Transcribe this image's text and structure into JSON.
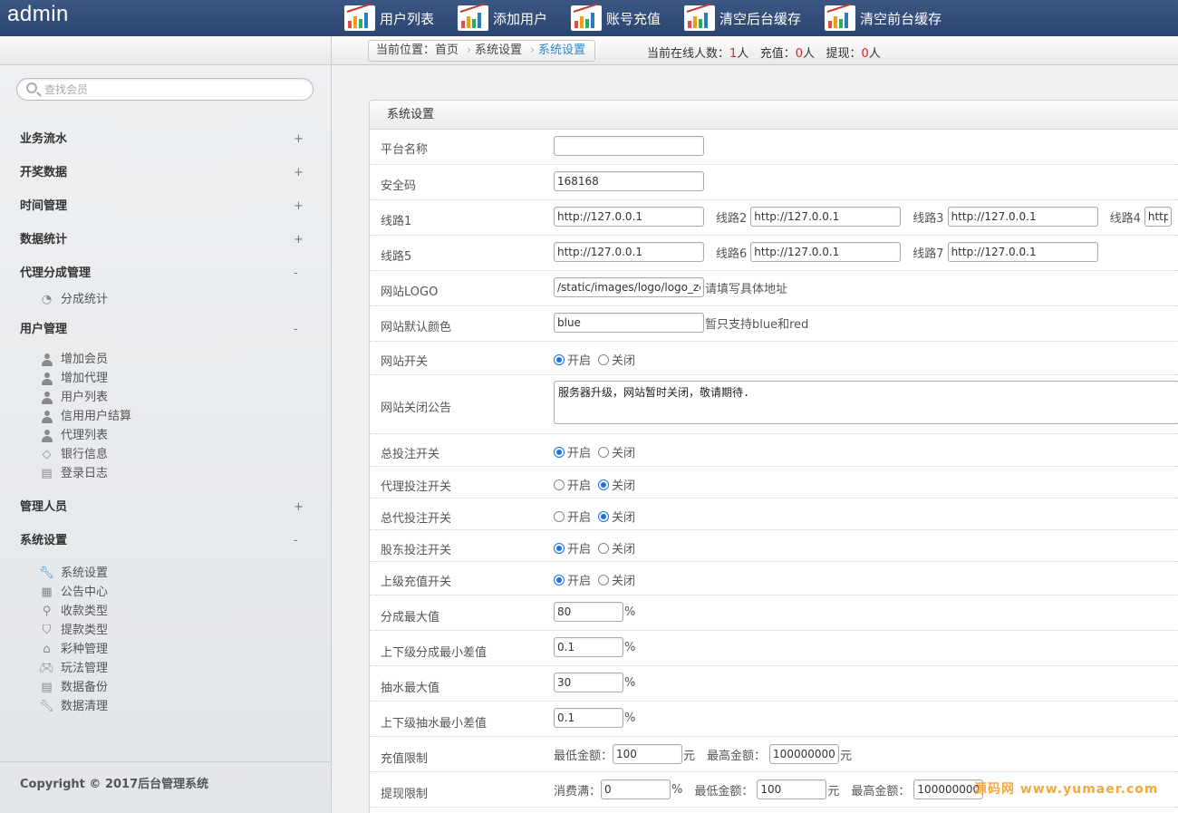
{
  "app": {
    "title": "admin"
  },
  "topnav": [
    {
      "label": "用户列表"
    },
    {
      "label": "添加用户"
    },
    {
      "label": "账号充值"
    },
    {
      "label": "清空后台缓存"
    },
    {
      "label": "清空前台缓存"
    }
  ],
  "search": {
    "placeholder": "查找会员"
  },
  "sidebar": {
    "groups": [
      {
        "label": "业务流水",
        "toggle": "+"
      },
      {
        "label": "开奖数据",
        "toggle": "+"
      },
      {
        "label": "时间管理",
        "toggle": "+"
      },
      {
        "label": "数据统计",
        "toggle": "+"
      },
      {
        "label": "代理分成管理",
        "toggle": "-",
        "items": [
          {
            "label": "分成统计",
            "icon": "pie-icon"
          }
        ]
      },
      {
        "label": "用户管理",
        "toggle": "-",
        "items": [
          {
            "label": "增加会员",
            "icon": "user-add-icon"
          },
          {
            "label": "增加代理",
            "icon": "user-add-icon"
          },
          {
            "label": "用户列表",
            "icon": "user-icon"
          },
          {
            "label": "信用用户结算",
            "icon": "user-icon"
          },
          {
            "label": "代理列表",
            "icon": "user-icon"
          },
          {
            "label": "银行信息",
            "icon": "diamond-icon"
          },
          {
            "label": "登录日志",
            "icon": "log-icon"
          }
        ]
      },
      {
        "label": "管理人员",
        "toggle": "+"
      },
      {
        "label": "系统设置",
        "toggle": "-",
        "items": [
          {
            "label": "系统设置",
            "icon": "wrench-icon"
          },
          {
            "label": "公告中心",
            "icon": "doc-icon"
          },
          {
            "label": "收款类型",
            "icon": "search-icon"
          },
          {
            "label": "提款类型",
            "icon": "shield-icon"
          },
          {
            "label": "彩种管理",
            "icon": "home-icon"
          },
          {
            "label": "玩法管理",
            "icon": "gamepad-icon"
          },
          {
            "label": "数据备份",
            "icon": "log-icon"
          },
          {
            "label": "数据清理",
            "icon": "wrench-icon"
          }
        ]
      }
    ],
    "copyright": "Copyright © 2017后台管理系统"
  },
  "breadcrumb": {
    "prefix": "当前位置：首页",
    "mid": "系统设置",
    "current": "系统设置"
  },
  "online": {
    "label1": "当前在线人数：",
    "count1": "1",
    "unit1": "人",
    "label2": "充值：",
    "count2": "0",
    "unit2": "人",
    "label3": "提现：",
    "count3": "0",
    "unit3": "人"
  },
  "panel": {
    "title": "系统设置"
  },
  "form": {
    "platform_name": {
      "label": "平台名称",
      "value": ""
    },
    "security_code": {
      "label": "安全码",
      "value": "168168"
    },
    "lines_a": {
      "label": "线路1",
      "value1": "http://127.0.0.1",
      "label2": "线路2",
      "value2": "http://127.0.0.1",
      "label3": "线路3",
      "value3": "http://127.0.0.1",
      "label4": "线路4",
      "value4": "http://"
    },
    "lines_b": {
      "label": "线路5",
      "value1": "http://127.0.0.1",
      "label2": "线路6",
      "value2": "http://127.0.0.1",
      "label3": "线路7",
      "value3": "http://127.0.0.1"
    },
    "logo": {
      "label": "网站LOGO",
      "value": "/static/images/logo/logo_zc.png",
      "hint": "请填写具体地址"
    },
    "color": {
      "label": "网站默认颜色",
      "value": "blue",
      "hint": "暂只支持blue和red"
    },
    "site_switch": {
      "label": "网站开关"
    },
    "close_notice": {
      "label": "网站关闭公告",
      "value": "服务器升级，网站暂时关闭，敬请期待."
    },
    "bet_total": {
      "label": "总投注开关"
    },
    "bet_agent": {
      "label": "代理投注开关"
    },
    "bet_general": {
      "label": "总代投注开关"
    },
    "bet_shareholder": {
      "label": "股东投注开关"
    },
    "recharge_parent": {
      "label": "上级充值开关"
    },
    "share_max": {
      "label": "分成最大值",
      "value": "80",
      "unit": "%"
    },
    "share_diff": {
      "label": "上下级分成最小差值",
      "value": "0.1",
      "unit": "%"
    },
    "rebate_max": {
      "label": "抽水最大值",
      "value": "30",
      "unit": "%"
    },
    "rebate_diff": {
      "label": "上下级抽水最小差值",
      "value": "0.1",
      "unit": "%"
    },
    "recharge_limit": {
      "label": "充值限制",
      "min_label": "最低金额：",
      "min": "100",
      "min_unit": "元",
      "max_label": "最高金额：",
      "max": "100000000",
      "max_unit": "元"
    },
    "withdraw_limit": {
      "label": "提现限制",
      "consume_label": "消费满：",
      "consume": "0",
      "consume_unit": "%",
      "min_label": "最低金额：",
      "min": "100",
      "min_unit": "元",
      "max_label": "最高金额：",
      "max": "100000000"
    },
    "on_label": "开启",
    "off_label": "关闭"
  },
  "watermark": "源码网 www.yumaer.com"
}
